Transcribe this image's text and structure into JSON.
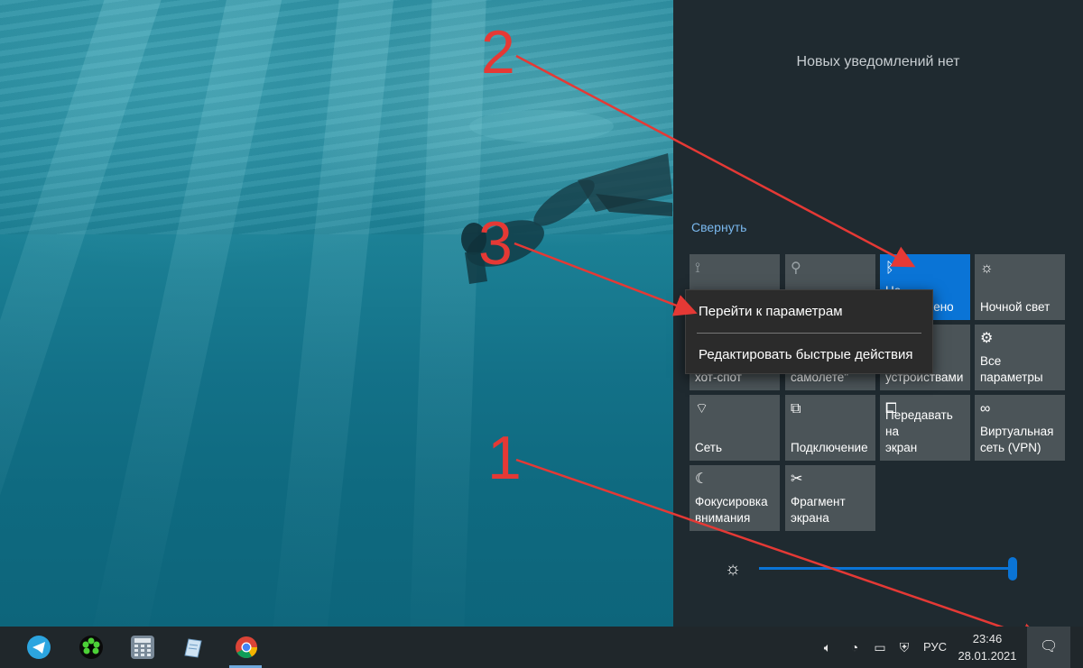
{
  "action_center": {
    "no_notifications": "Новых уведомлений нет",
    "collapse_label": "Свернуть",
    "tiles": [
      {
        "label": "",
        "icon": "location-icon",
        "glyph": "⟟",
        "state": "dim"
      },
      {
        "label": "",
        "icon": "battery-saver-icon",
        "glyph": "⚲",
        "state": "dim"
      },
      {
        "label": "Не подключено",
        "icon": "bluetooth-icon",
        "glyph": "ᛒ",
        "state": "active"
      },
      {
        "label": "Ночной свет",
        "icon": "night-light-icon",
        "glyph": "☼",
        "state": "normal"
      },
      {
        "label": "хот-спот",
        "icon": "hotspot-icon",
        "glyph": "⌁",
        "state": "normal"
      },
      {
        "label": "самолете\"",
        "icon": "airplane-icon",
        "glyph": "✈",
        "state": "normal"
      },
      {
        "label": "устройствами",
        "icon": "devices-icon",
        "glyph": "▭",
        "state": "normal"
      },
      {
        "label": "Все\nпараметры",
        "icon": "gear-icon",
        "glyph": "⚙",
        "state": "normal"
      },
      {
        "label": "Сеть",
        "icon": "network-icon",
        "glyph": "⌔",
        "state": "normal"
      },
      {
        "label": "Подключение",
        "icon": "connect-icon",
        "glyph": "⧉",
        "state": "normal"
      },
      {
        "label": "Передавать на\nэкран",
        "icon": "project-icon",
        "glyph": "⧠",
        "state": "normal"
      },
      {
        "label": "Виртуальная\nсеть (VPN)",
        "icon": "vpn-icon",
        "glyph": "∞",
        "state": "normal"
      },
      {
        "label": "Фокусировка\nвнимания",
        "icon": "focus-assist-icon",
        "glyph": "☾",
        "state": "normal"
      },
      {
        "label": "Фрагмент\nэкрана",
        "icon": "snip-icon",
        "glyph": "✂",
        "state": "normal"
      }
    ],
    "brightness": {
      "icon": "brightness-icon",
      "level": 1.0
    }
  },
  "context_menu": {
    "items": [
      "Перейти к параметрам",
      "Редактировать быстрые действия"
    ]
  },
  "annotations": {
    "labels": [
      "2",
      "3",
      "1"
    ],
    "color": "#e53935"
  },
  "taskbar": {
    "apps": [
      {
        "name": "telegram-icon",
        "color": "#2ca5e0"
      },
      {
        "name": "icq-icon",
        "color": "#0a0a0a"
      },
      {
        "name": "calculator-icon",
        "color": "#7a8a99"
      },
      {
        "name": "notepad-icon",
        "color": "#9fc3e0"
      },
      {
        "name": "chrome-icon",
        "color": "#db4437"
      }
    ],
    "tray": {
      "language": "РУС",
      "time": "23:46",
      "date": "28.01.2021"
    }
  }
}
